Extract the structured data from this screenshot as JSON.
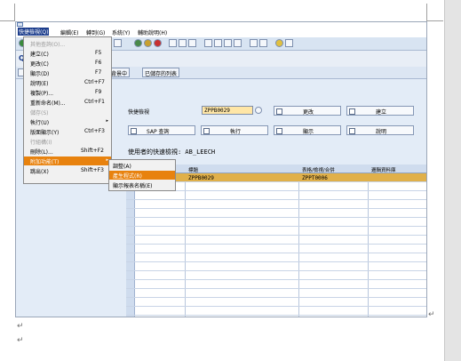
{
  "menubar": [
    {
      "label": "快捷檢視(Q)",
      "active": true
    },
    {
      "label": "編輯(E)"
    },
    {
      "label": "轉到(G)"
    },
    {
      "label": "系統(Y)"
    },
    {
      "label": "輔助說明(H)"
    }
  ],
  "main_menu": [
    {
      "label": "其他查詢(O)...",
      "shortcut": "",
      "disabled": true
    },
    {
      "label": "建立(C)",
      "shortcut": "F5"
    },
    {
      "label": "更改(C)",
      "shortcut": "F6"
    },
    {
      "label": "顯示(D)",
      "shortcut": "F7"
    },
    {
      "label": "說明(E)",
      "shortcut": "Ctrl+F7"
    },
    {
      "label": "複製(P)...",
      "shortcut": "F9"
    },
    {
      "label": "重新命名(M)...",
      "shortcut": "Ctrl+F1"
    },
    {
      "label": "儲存(S)",
      "shortcut": "",
      "disabled": true
    },
    {
      "label": "執行(U)",
      "shortcut": "",
      "submenu": true
    },
    {
      "label": "版面顯示(Y)",
      "shortcut": "Ctrl+F3"
    },
    {
      "label": "行組構(I)",
      "shortcut": "",
      "disabled": true
    },
    {
      "label": "刪除(L)...",
      "shortcut": "Shift+F2"
    },
    {
      "label": "附加功能(T)",
      "shortcut": "",
      "submenu": true,
      "highlighted": true
    },
    {
      "label": "跳出(X)",
      "shortcut": "Shift+F3"
    }
  ],
  "sub_menu": [
    {
      "label": "調整(A)"
    },
    {
      "label": "產生程式(R)",
      "highlighted": true
    },
    {
      "label": "顯示報表名稱(E)"
    }
  ],
  "toolbar2": {
    "btn1": "背景中",
    "btn2": "已儲存的列表"
  },
  "form": {
    "quickview_label": "快捷檢視",
    "quickview_value": "ZPPB0029",
    "change_btn": "更改",
    "create_btn": "建立",
    "sap_query_btn": "SAP 查詢",
    "execute_btn": "執行",
    "display_btn": "顯示",
    "describe_btn": "說明",
    "user_views_label": "使用者的快速檢視: AB_LEECH"
  },
  "table": {
    "headers": [
      "標題",
      "表格/檢視/合併",
      "邏輯資料庫"
    ],
    "rows": [
      {
        "c1": "ZPPB0029",
        "c2": "ZPPT0006",
        "c3": ""
      }
    ]
  },
  "para_marks": [
    "↵",
    "↵",
    "↵"
  ],
  "colors": {
    "highlight": "#e8820e",
    "accent": "#1c3d8c",
    "selected_row": "#e0b04a"
  }
}
